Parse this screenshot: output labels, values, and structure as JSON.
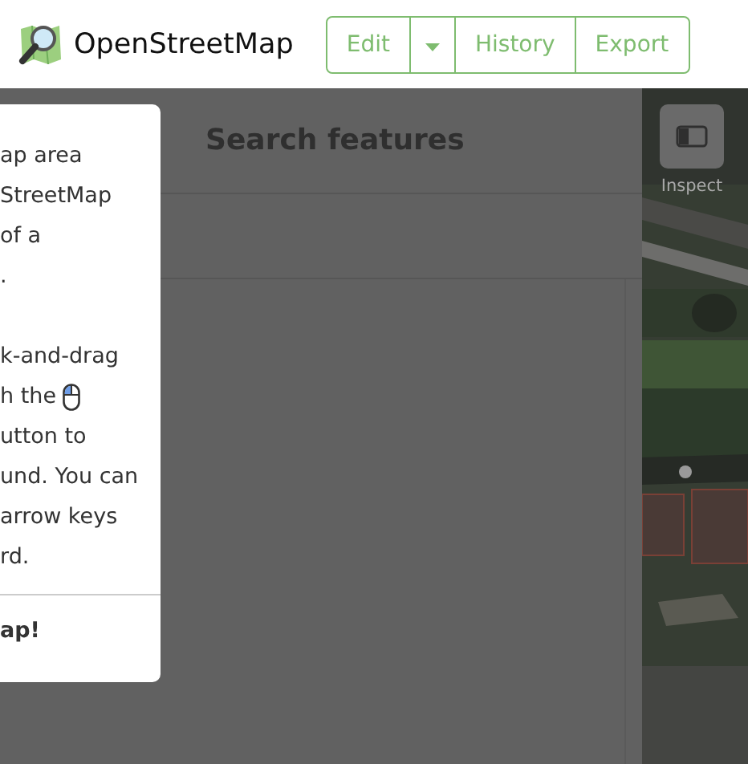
{
  "header": {
    "logo_text": "OpenStreetMap",
    "buttons": [
      {
        "kind": "text",
        "label": "Edit"
      },
      {
        "kind": "dropdown"
      },
      {
        "kind": "text",
        "label": "History"
      },
      {
        "kind": "text",
        "label": "Export"
      }
    ]
  },
  "sidebar": {
    "title": "Search features"
  },
  "map": {
    "inspect_label": "Inspect"
  },
  "popup": {
    "paragraphs": [
      [
        {
          "text": "ap area"
        },
        {
          "text": "StreetMap"
        },
        {
          "text": "of a"
        },
        {
          "text": "."
        }
      ],
      [
        {
          "text": "k-and-drag"
        },
        {
          "text": "h the",
          "kind": "mouse"
        },
        {
          "text": "utton to"
        },
        {
          "text": "und. You can"
        },
        {
          "text": "arrow keys"
        },
        {
          "text": "rd."
        }
      ]
    ],
    "footer": "ap!"
  }
}
